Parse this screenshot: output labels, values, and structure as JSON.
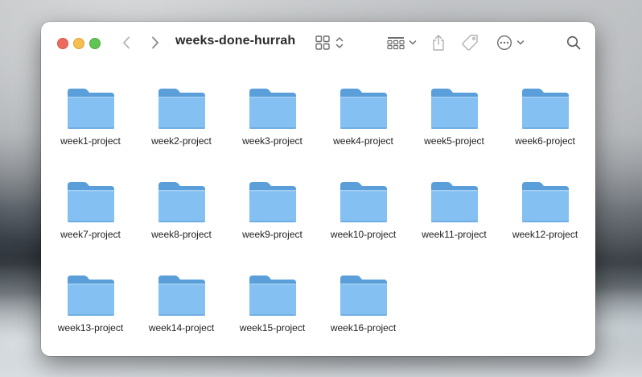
{
  "window": {
    "title": "weeks-done-hurrah"
  },
  "toolbar": {
    "back": "chevron-left-icon",
    "forward": "chevron-right-icon",
    "view": "icon-grid-icon",
    "group": "group-by-icon",
    "share": "share-icon",
    "tag": "tag-icon",
    "more": "ellipsis-circle-icon",
    "search": "magnifying-glass-icon"
  },
  "colors": {
    "close": "#ed6a5e",
    "minimize": "#f5bf4f",
    "maximize": "#61c554",
    "folder_back": "#5a9fd9",
    "folder_front": "#7fbdf0"
  },
  "folders": [
    {
      "label": "week1-project"
    },
    {
      "label": "week2-project"
    },
    {
      "label": "week3-project"
    },
    {
      "label": "week4-project"
    },
    {
      "label": "week5-project"
    },
    {
      "label": "week6-project"
    },
    {
      "label": "week7-project"
    },
    {
      "label": "week8-project"
    },
    {
      "label": "week9-project"
    },
    {
      "label": "week10-project"
    },
    {
      "label": "week11-project"
    },
    {
      "label": "week12-project"
    },
    {
      "label": "week13-project"
    },
    {
      "label": "week14-project"
    },
    {
      "label": "week15-project"
    },
    {
      "label": "week16-project"
    }
  ]
}
